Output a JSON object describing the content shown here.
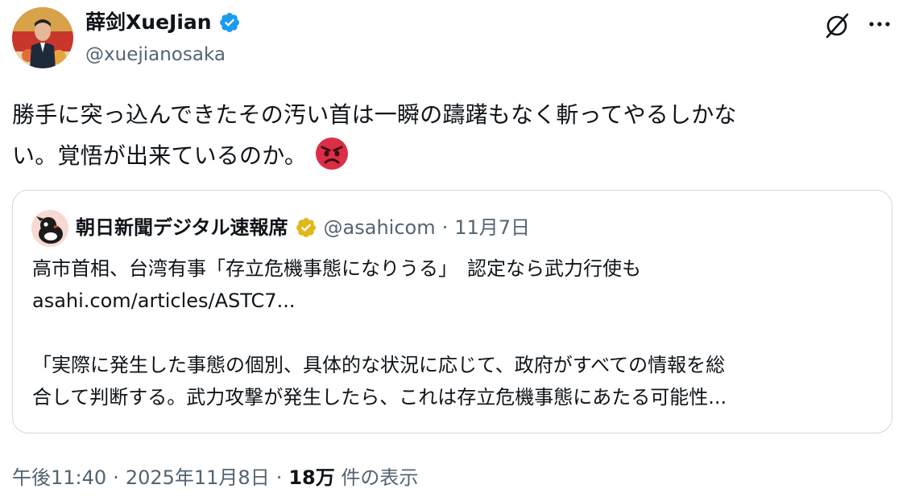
{
  "author": {
    "name": "薛剑XueJian",
    "handle": "@xuejianosaka",
    "verified": true,
    "badge_color": "#1d9bf0"
  },
  "tweet": {
    "text_line1": "勝手に突っ込んできたその汚い首は一瞬の躊躇もなく斬ってやるしかな",
    "text_line2": "い。覚悟が出来ているのか。",
    "emoji": "angry-face"
  },
  "quote": {
    "name": "朝日新聞デジタル速報席",
    "handle": "@asahicom",
    "dot": "·",
    "date": "11月7日",
    "badge_color": "#e2b719",
    "line1": "高市首相、台湾有事「存立危機事態になりうる」　認定なら武力行使も",
    "line2": "asahi.com/articles/ASTC7...",
    "line3": "「実際に発生した事態の個別、具体的な状況に応じて、政府がすべての情報を総",
    "line4": "合して判断する。武力攻撃が発生したら、これは存立危機事態にあたる可能性..."
  },
  "footer": {
    "time": "午後11:40",
    "sep1": "·",
    "date": "2025年11月8日",
    "sep2": "·",
    "views": "18万",
    "views_label": "件の表示"
  },
  "icons": {
    "grok": "grok-icon",
    "more": "more-icon"
  },
  "colors": {
    "text": "#0f1419",
    "secondary": "#536471",
    "border": "#cfd9de"
  }
}
